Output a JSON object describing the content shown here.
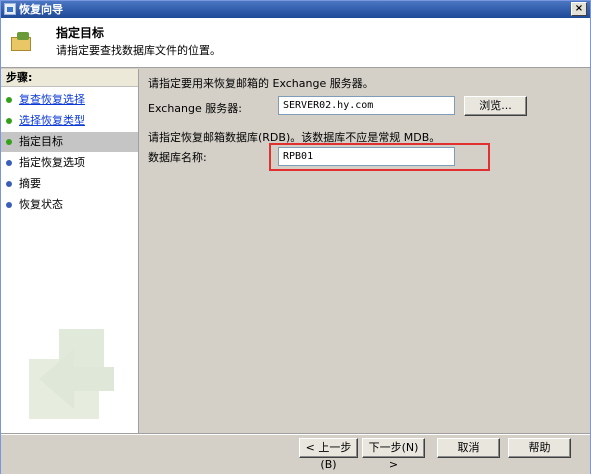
{
  "window": {
    "title": "恢复向导",
    "close_glyph": "×"
  },
  "header": {
    "title": "指定目标",
    "subtitle": "请指定要查找数据库文件的位置。",
    "icon": "folder-restore-icon"
  },
  "steps": {
    "heading": "步骤:",
    "items": [
      {
        "label": "复查恢复选择",
        "state": "done",
        "link": true
      },
      {
        "label": "选择恢复类型",
        "state": "done",
        "link": true
      },
      {
        "label": "指定目标",
        "state": "current",
        "link": false
      },
      {
        "label": "指定恢复选项",
        "state": "pending",
        "link": false
      },
      {
        "label": "摘要",
        "state": "pending",
        "link": false
      },
      {
        "label": "恢复状态",
        "state": "pending",
        "link": false
      }
    ]
  },
  "main": {
    "server_prompt": "请指定要用来恢复邮箱的 Exchange 服务器。",
    "server_label": "Exchange 服务器:",
    "server_value": "SERVER02.hy.com",
    "browse_label": "浏览...",
    "rdb_prompt": "请指定恢复邮箱数据库(RDB)。该数据库不应是常规 MDB。",
    "db_name_label": "数据库名称:",
    "db_name_value": "RPB01"
  },
  "footer": {
    "back_label": "< 上一步(B)",
    "next_label": "下一步(N) >",
    "cancel_label": "取消",
    "help_label": "帮助"
  },
  "colors": {
    "link": "#0b39d6",
    "done_dot": "#34a11a",
    "pending_dot": "#3a5fb8",
    "highlight": "#e03030"
  }
}
